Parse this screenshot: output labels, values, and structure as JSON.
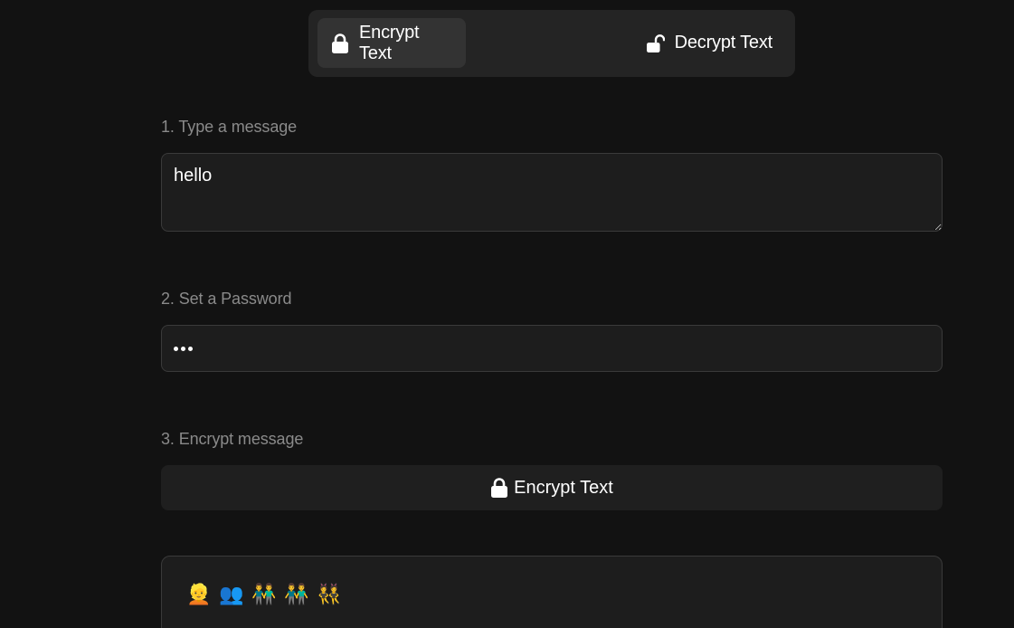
{
  "mode_toggle": {
    "encrypt_label": "Encrypt Text",
    "decrypt_label": "Decrypt Text",
    "active": "encrypt"
  },
  "step1": {
    "label": "1. Type a message",
    "value": "hello"
  },
  "step2": {
    "label": "2. Set a Password",
    "masked_length": 3
  },
  "step3": {
    "label": "3. Encrypt message",
    "button_label": "Encrypt Text"
  },
  "output": {
    "emojis": [
      "👱",
      "👥",
      "👬",
      "👬",
      "👯"
    ]
  },
  "colors": {
    "background": "#121212",
    "panel": "#242424",
    "active_tab": "#333333",
    "field": "#1d1d1d",
    "border": "#3a3a3a",
    "label": "#8a8a8a"
  },
  "icons": {
    "encrypt_tab": "lock-icon",
    "decrypt_tab": "unlock-icon",
    "encrypt_button": "lock-icon"
  }
}
